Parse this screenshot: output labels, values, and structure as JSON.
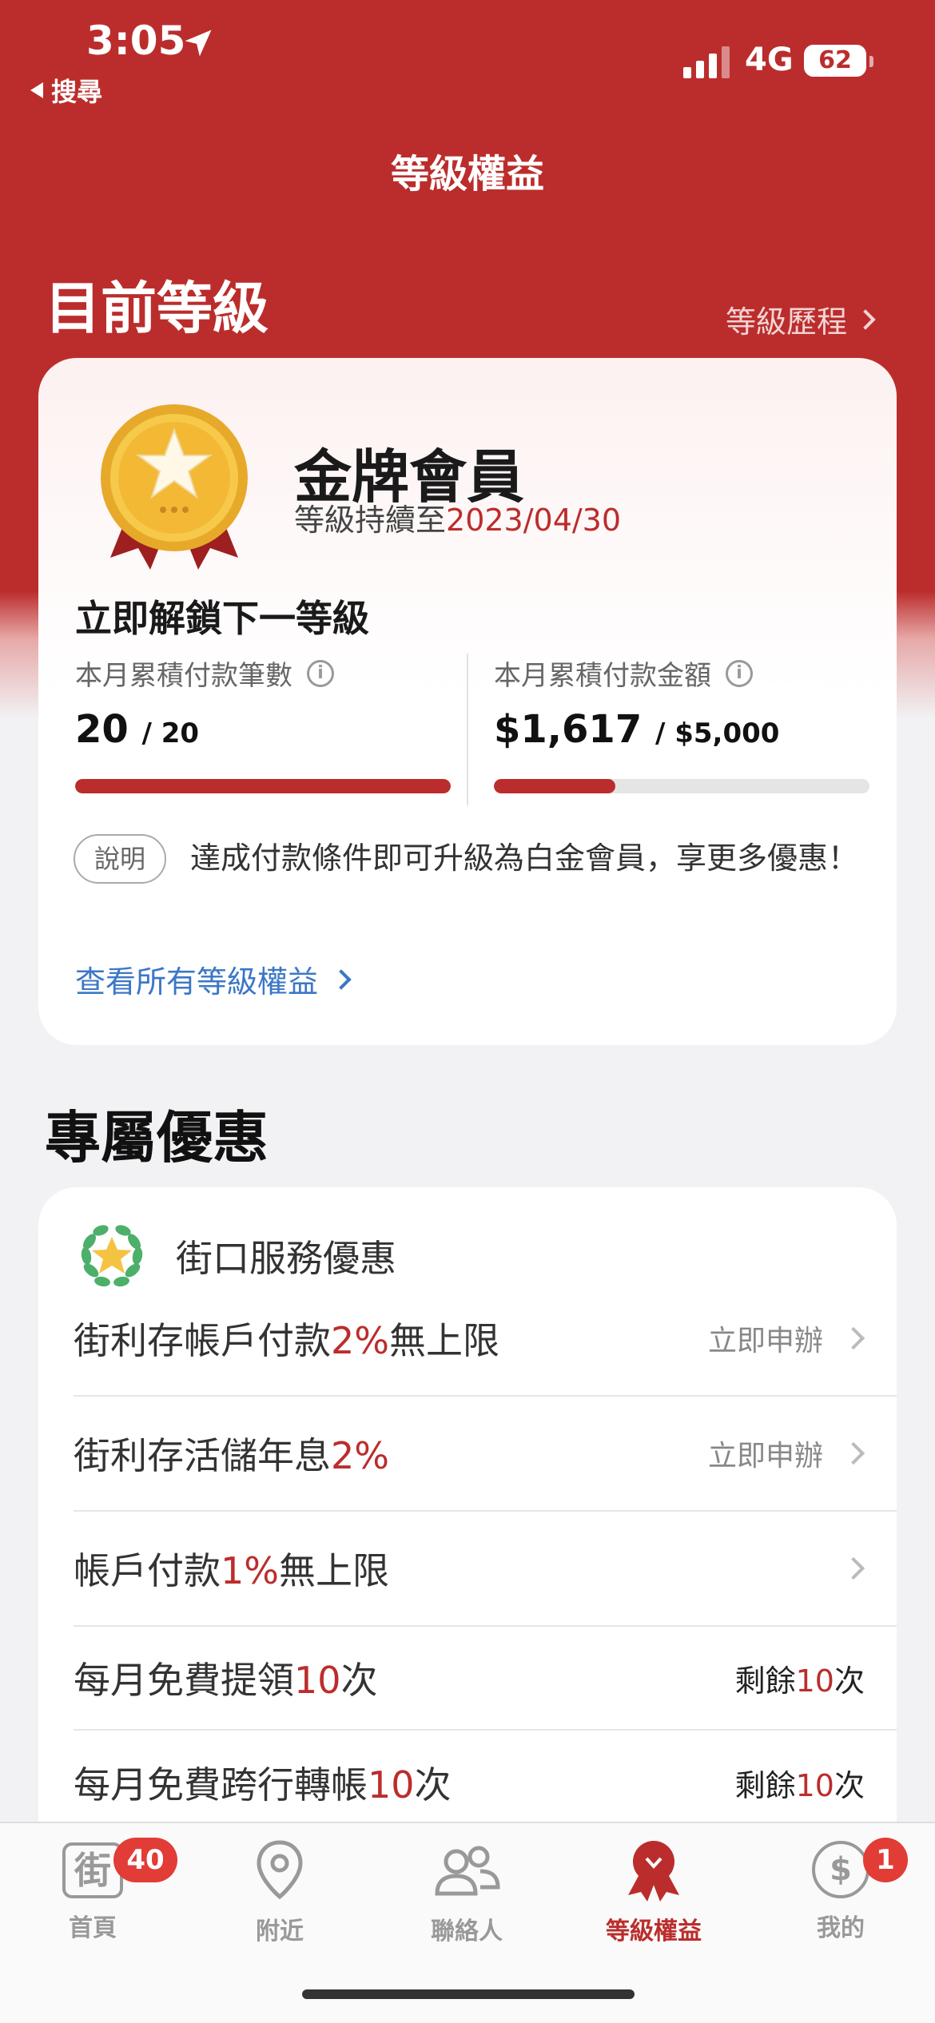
{
  "status_bar": {
    "time": "3:05",
    "back_label": "搜尋",
    "network": "4G",
    "battery": "62"
  },
  "nav": {
    "title": "等級權益"
  },
  "current_level": {
    "section_title": "目前等級",
    "history_link": "等級歷程",
    "tier_name": "金牌會員",
    "valid_prefix": "等級持續至",
    "valid_date": "2023/04/30",
    "unlock_title": "立即解鎖下一等級",
    "metrics": [
      {
        "label": "本月累積付款筆數",
        "value": "20",
        "goal": "/ 20",
        "progress": 1.0
      },
      {
        "label": "本月累積付款金額",
        "value": "$1,617",
        "goal": "/ $5,000",
        "progress": 0.3234
      }
    ],
    "note_pill": "說明",
    "note_text": "達成付款條件即可升級為白金會員，享更多優惠！",
    "all_benefits_link": "查看所有等級權益"
  },
  "offers": {
    "section_title": "專屬優惠",
    "card_title": "街口服務優惠",
    "rows": [
      {
        "pre": "街利存帳戶付款",
        "hl": "2%",
        "post": "無上限",
        "action": "立即申辦"
      },
      {
        "pre": "街利存活儲年息",
        "hl": "2%",
        "post": "",
        "action": "立即申辦"
      },
      {
        "pre": "帳戶付款",
        "hl": "1%",
        "post": "無上限",
        "action": ""
      },
      {
        "pre": "每月免費提領",
        "hl": "10",
        "post": "次",
        "remain_pre": "剩餘",
        "remain_hl": "10",
        "remain_post": "次"
      },
      {
        "pre": "每月免費跨行轉帳",
        "hl": "10",
        "post": "次",
        "remain_pre": "剩餘",
        "remain_hl": "10",
        "remain_post": "次"
      }
    ]
  },
  "tabbar": {
    "tabs": [
      {
        "label": "首頁",
        "badge": "40",
        "icon": "home-jie-icon"
      },
      {
        "label": "附近",
        "icon": "location-pin-icon"
      },
      {
        "label": "聯絡人",
        "icon": "contacts-icon"
      },
      {
        "label": "等級權益",
        "icon": "medal-ribbon-icon",
        "active": true
      },
      {
        "label": "我的",
        "badge": "1",
        "icon": "dollar-circle-icon"
      }
    ],
    "home_glyph": "街",
    "dollar_glyph": "$"
  },
  "colors": {
    "brand_red": "#bb2d2c",
    "link_blue": "#3b77c6",
    "badge_red": "#e23c36"
  }
}
